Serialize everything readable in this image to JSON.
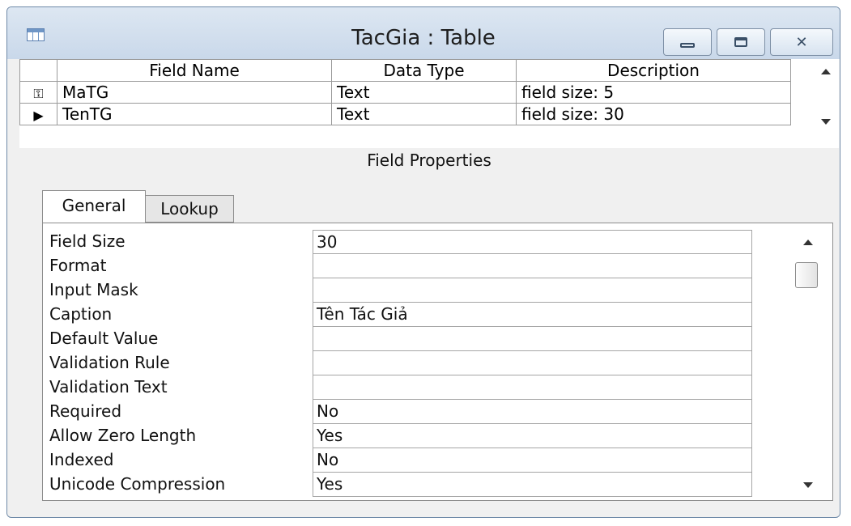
{
  "window": {
    "title": "TacGia : Table"
  },
  "grid": {
    "columns": [
      "Field Name",
      "Data Type",
      "Description"
    ],
    "rows": [
      {
        "selector": "key",
        "name": "MaTG",
        "type": "Text",
        "description": "field size: 5"
      },
      {
        "selector": "current",
        "name": "TenTG",
        "type": "Text",
        "description": "field size: 30"
      }
    ]
  },
  "field_properties": {
    "header": "Field Properties",
    "tabs": [
      "General",
      "Lookup"
    ],
    "active_tab": "General",
    "properties": [
      {
        "label": "Field Size",
        "value": "30"
      },
      {
        "label": "Format",
        "value": ""
      },
      {
        "label": "Input Mask",
        "value": ""
      },
      {
        "label": "Caption",
        "value": "Tên Tác Giả"
      },
      {
        "label": "Default Value",
        "value": ""
      },
      {
        "label": "Validation Rule",
        "value": ""
      },
      {
        "label": "Validation Text",
        "value": ""
      },
      {
        "label": "Required",
        "value": "No"
      },
      {
        "label": "Allow Zero Length",
        "value": "Yes"
      },
      {
        "label": "Indexed",
        "value": "No"
      },
      {
        "label": "Unicode Compression",
        "value": "Yes"
      }
    ]
  }
}
